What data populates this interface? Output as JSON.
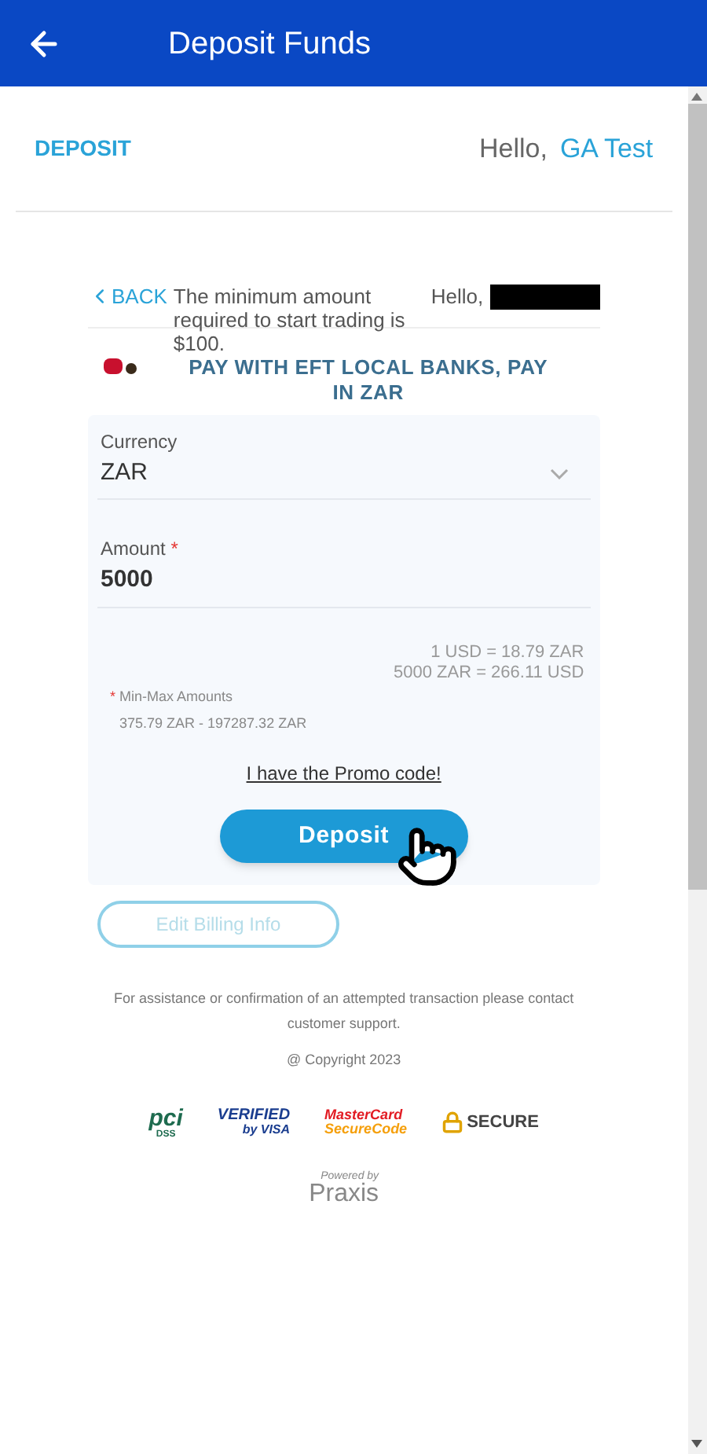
{
  "app_bar": {
    "title": "Deposit Funds"
  },
  "header": {
    "tab": "DEPOSIT",
    "greeting": "Hello,",
    "user": "GA Test"
  },
  "widget": {
    "back": "BACK",
    "notice": "The minimum amount required to start trading is $100.",
    "greeting": "Hello,",
    "method": "PAY WITH EFT LOCAL BANKS, PAY IN ZAR",
    "currency": {
      "label": "Currency",
      "value": "ZAR"
    },
    "amount": {
      "label": "Amount",
      "required": "*",
      "value": "5000"
    },
    "rates": [
      "1 USD = 18.79 ZAR",
      "5000 ZAR = 266.11 USD"
    ],
    "limits": {
      "mark": "*",
      "label": "Min-Max Amounts",
      "range": "375.79 ZAR - 197287.32 ZAR"
    },
    "promo": "I have the Promo code!",
    "submit": "Deposit"
  },
  "edit_billing": "Edit Billing Info",
  "footer": {
    "note": "For assistance or confirmation of an attempted transaction please contact customer support.",
    "copyright": "@ Copyright 2023",
    "badges": [
      {
        "kind": "pci",
        "lines": [
          "pci",
          "DSS"
        ]
      },
      {
        "kind": "visa",
        "lines": [
          "VERIFIED",
          "by VISA"
        ]
      },
      {
        "kind": "mastercard",
        "lines": [
          "MasterCard",
          "SecureCode"
        ]
      },
      {
        "kind": "secure",
        "lines": [
          "SECURE"
        ]
      }
    ],
    "powered_by": "Powered by",
    "brand": "Praxis"
  }
}
